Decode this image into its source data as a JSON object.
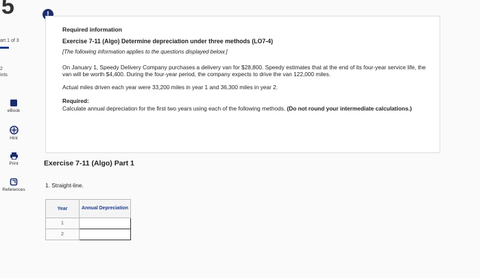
{
  "sidebar": {
    "big_number": "5",
    "part": "art 1 of 3",
    "points": "2\nints",
    "items": [
      {
        "label": "eBook",
        "icon": "book-icon"
      },
      {
        "label": "Hint",
        "icon": "hint-icon"
      },
      {
        "label": "Print",
        "icon": "print-icon"
      },
      {
        "label": "References",
        "icon": "references-icon"
      }
    ]
  },
  "panel": {
    "alert": "!",
    "required_info": "Required information",
    "exercise_title": "Exercise 7-11 (Algo) Determine depreciation under three methods (LO7-4)",
    "note": "[The following information applies to the questions displayed below.]",
    "paragraph1": "On January 1, Speedy Delivery Company purchases a delivery van for $28,800. Speedy estimates that at the end of its four-year service life, the van will be worth $4,400. During the four-year period, the company expects to drive the van 122,000 miles.",
    "paragraph2": "Actual miles driven each year were 33,200 miles in year 1 and 36,300 miles in year 2.",
    "required_label": "Required:",
    "required_text": "Calculate annual depreciation for the first two years using each of the following methods.",
    "required_bold": "(Do not round your intermediate calculations.)"
  },
  "part": {
    "title": "Exercise 7-11 (Algo) Part 1",
    "question": "1. Straight-line."
  },
  "table": {
    "headers": [
      "Year",
      "Annual Depreciation"
    ],
    "rows": [
      {
        "year": "1",
        "value": ""
      },
      {
        "year": "2",
        "value": ""
      }
    ]
  }
}
